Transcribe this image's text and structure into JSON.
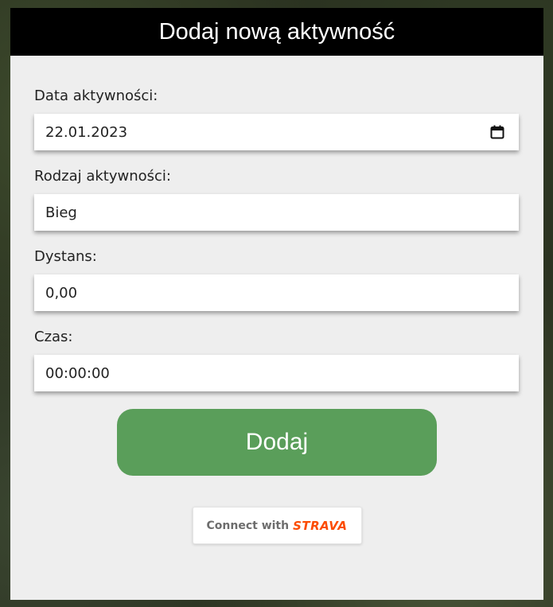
{
  "header": {
    "title": "Dodaj nową aktywność"
  },
  "form": {
    "date": {
      "label": "Data aktywności:",
      "value": "22.01.2023",
      "icon": "calendar-icon"
    },
    "activity_type": {
      "label": "Rodzaj aktywności:",
      "value": "Bieg"
    },
    "distance": {
      "label": "Dystans:",
      "value": "0,00"
    },
    "time": {
      "label": "Czas:",
      "value": "00:00:00"
    },
    "submit_label": "Dodaj"
  },
  "strava": {
    "connect_text": "Connect with",
    "brand": "STRAVA"
  },
  "colors": {
    "header_bg": "#000000",
    "card_bg": "#eeeeee",
    "submit_bg": "#5a9e5a",
    "strava_orange": "#fc4c02"
  }
}
